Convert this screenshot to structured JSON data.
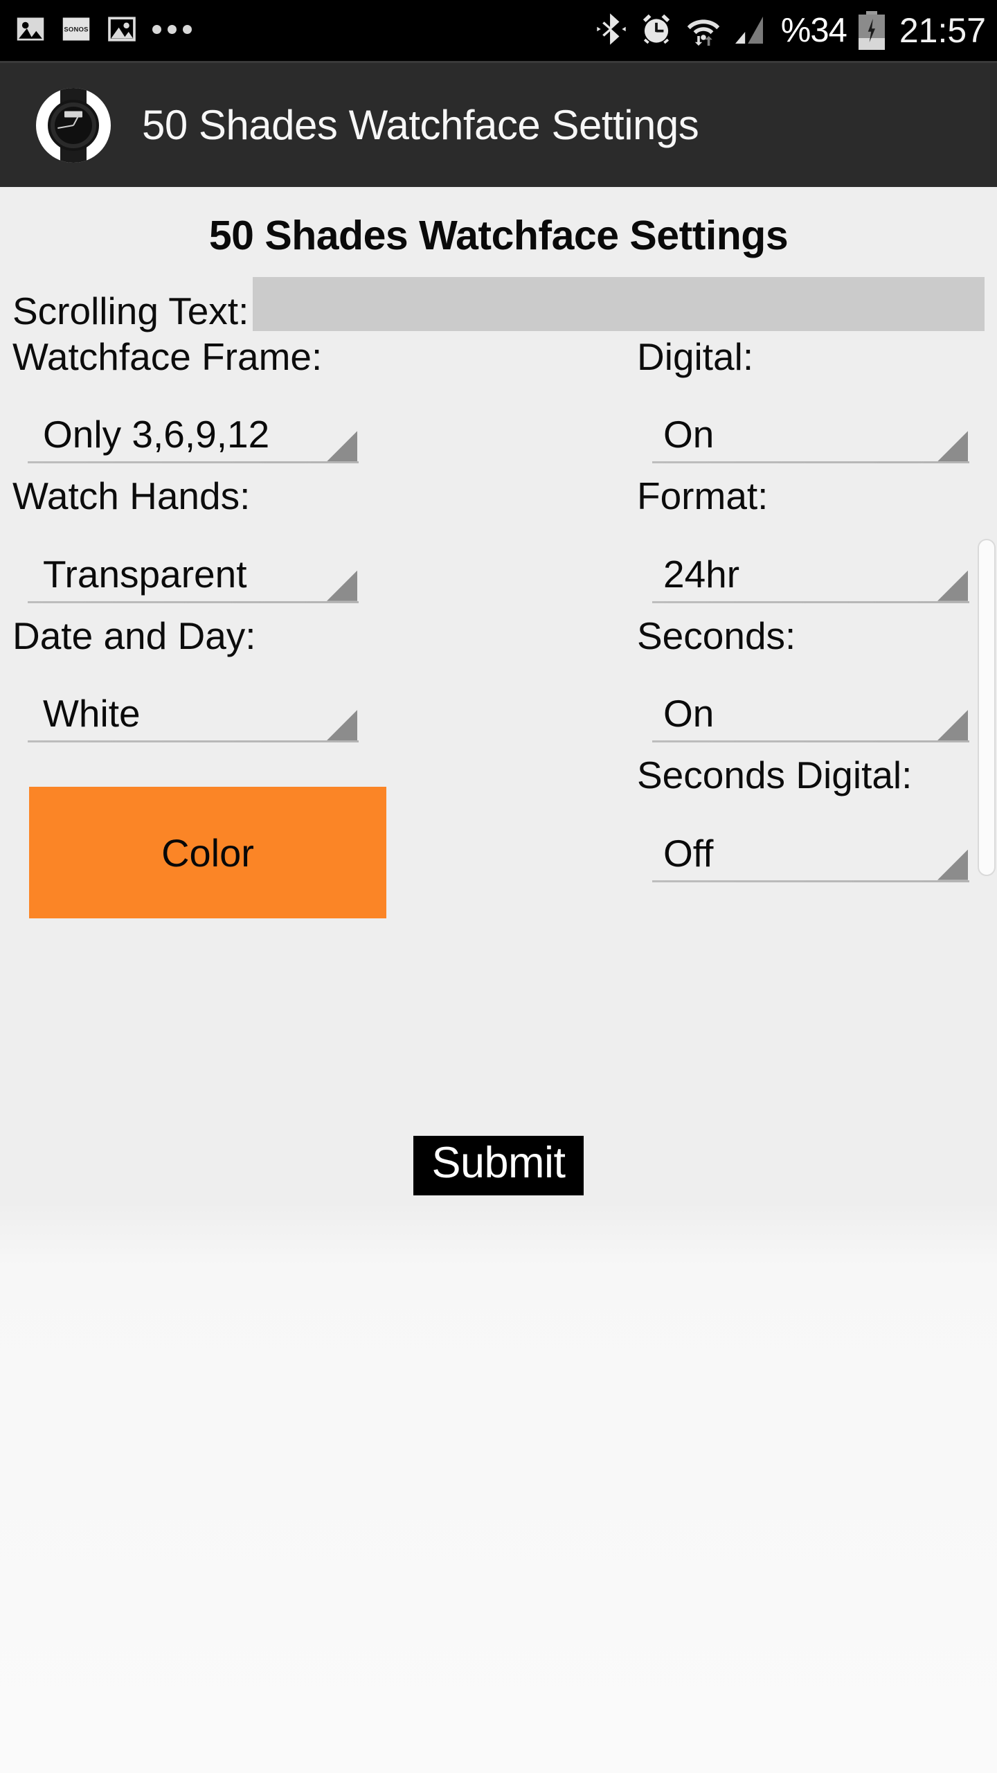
{
  "status_bar": {
    "left_icons": [
      {
        "name": "photo-filled-icon",
        "label": "image"
      },
      {
        "name": "sonos-icon",
        "label": "SONOS"
      },
      {
        "name": "photo-outline-icon",
        "label": "image"
      },
      {
        "name": "more-notifications-icon",
        "label": "..."
      }
    ],
    "right_icons": [
      {
        "name": "bluetooth-icon",
        "label": "Bluetooth"
      },
      {
        "name": "alarm-clock-icon",
        "label": "Alarm"
      },
      {
        "name": "wifi-icon",
        "label": "Wi-Fi"
      },
      {
        "name": "cell-signal-icon",
        "label": "Signal"
      }
    ],
    "battery_percent": "%34",
    "battery_state": "charging",
    "clock": "21:57"
  },
  "app_bar": {
    "icon_name": "watchface-app-icon",
    "title": "50 Shades Watchface Settings"
  },
  "page": {
    "title": "50 Shades Watchface Settings"
  },
  "scrolling_text": {
    "label": "Scrolling Text:",
    "value": "",
    "placeholder": ""
  },
  "left_column": [
    {
      "key": "watchface_frame",
      "label": "Watchface Frame:",
      "value": "Only 3,6,9,12"
    },
    {
      "key": "watch_hands",
      "label": "Watch Hands:",
      "value": "Transparent"
    },
    {
      "key": "date_and_day",
      "label": "Date and Day:",
      "value": "White"
    }
  ],
  "right_column": [
    {
      "key": "digital",
      "label": "Digital:",
      "value": "On"
    },
    {
      "key": "format",
      "label": "Format:",
      "value": "24hr"
    },
    {
      "key": "seconds",
      "label": "Seconds:",
      "value": "On"
    },
    {
      "key": "seconds_digital",
      "label": "Seconds Digital:",
      "value": "Off"
    }
  ],
  "color_button": {
    "label": "Color",
    "color": "#fb8526"
  },
  "submit_button": {
    "label": "Submit",
    "background": "#000000",
    "text_color": "#ffffff"
  },
  "theme": {
    "status_bar_bg": "#000000",
    "app_bar_bg": "#2b2b2b",
    "content_bg": "#eeeeee",
    "input_bg": "#cbcbcb",
    "accent": "#fb8526"
  }
}
